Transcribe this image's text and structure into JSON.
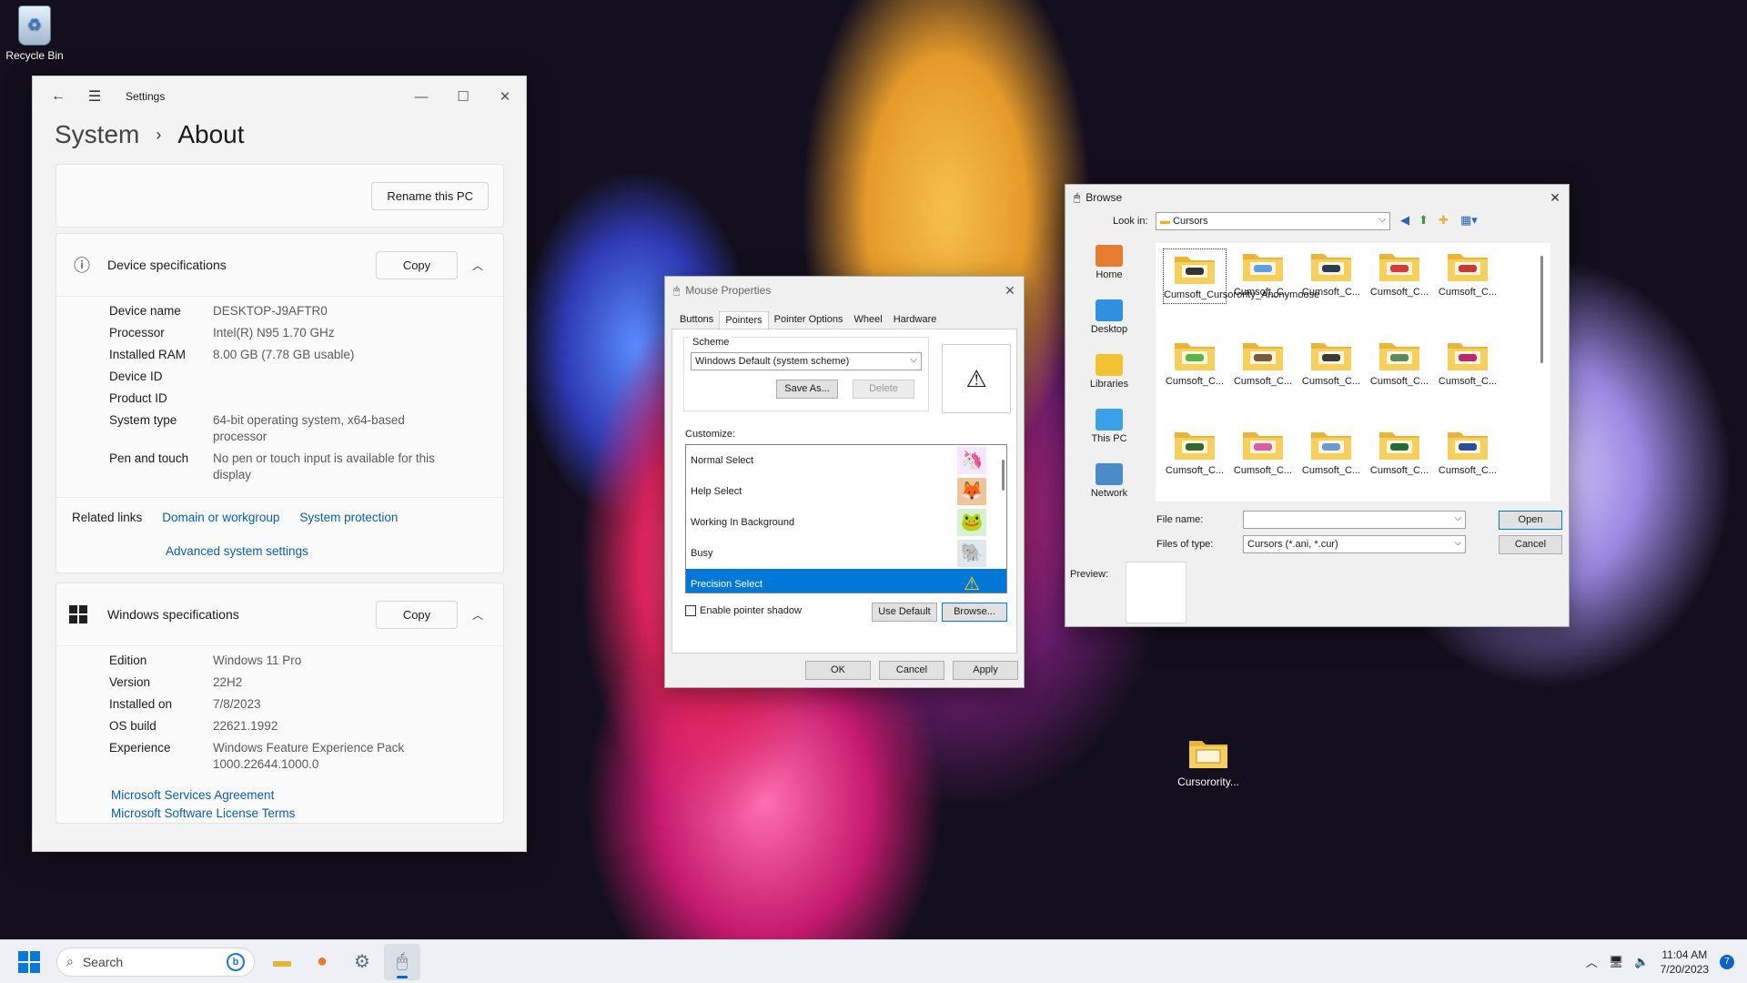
{
  "desktop": {
    "recycle_bin_label": "Recycle Bin",
    "cursority_label": "Cursorority..."
  },
  "settings": {
    "app_title": "Settings",
    "breadcrumb_parent": "System",
    "breadcrumb_current": "About",
    "rename_button": "Rename this PC",
    "device_specs": {
      "title": "Device specifications",
      "copy_button": "Copy",
      "rows": [
        {
          "k": "Device name",
          "v": "DESKTOP-J9AFTR0"
        },
        {
          "k": "Processor",
          "v": "Intel(R) N95   1.70 GHz"
        },
        {
          "k": "Installed RAM",
          "v": "8.00 GB (7.78 GB usable)"
        },
        {
          "k": "Device ID",
          "v": ""
        },
        {
          "k": "Product ID",
          "v": ""
        },
        {
          "k": "System type",
          "v": "64-bit operating system, x64-based processor"
        },
        {
          "k": "Pen and touch",
          "v": "No pen or touch input is available for this display"
        }
      ]
    },
    "related": {
      "label": "Related links",
      "domain_link": "Domain or workgroup",
      "protection_link": "System protection",
      "advanced_link": "Advanced system settings"
    },
    "windows_specs": {
      "title": "Windows specifications",
      "copy_button": "Copy",
      "rows": [
        {
          "k": "Edition",
          "v": "Windows 11 Pro"
        },
        {
          "k": "Version",
          "v": "22H2"
        },
        {
          "k": "Installed on",
          "v": "7/8/2023"
        },
        {
          "k": "OS build",
          "v": "22621.1992"
        },
        {
          "k": "Experience",
          "v": "Windows Feature Experience Pack 1000.22644.1000.0"
        }
      ],
      "msa_link": "Microsoft Services Agreement",
      "license_link": "Microsoft Software License Terms"
    }
  },
  "mouse": {
    "title": "Mouse Properties",
    "tabs": [
      "Buttons",
      "Pointers",
      "Pointer Options",
      "Wheel",
      "Hardware"
    ],
    "active_tab": "Pointers",
    "scheme_label": "Scheme",
    "scheme_value": "Windows Default (system scheme)",
    "save_as": "Save As...",
    "delete": "Delete",
    "customize_label": "Customize:",
    "cursors": [
      {
        "label": "Normal Select",
        "icon": "jester-cursor-icon",
        "glyph": "🦄",
        "bg": "#f4e7ff"
      },
      {
        "label": "Help Select",
        "icon": "fox-cursor-icon",
        "glyph": "🦊",
        "bg": "#f0c49a"
      },
      {
        "label": "Working In Background",
        "icon": "frog-cursor-icon",
        "glyph": "🐸",
        "bg": "#d6f2d2"
      },
      {
        "label": "Busy",
        "icon": "elephant-cursor-icon",
        "glyph": "🐘",
        "bg": "#dfe7ef"
      },
      {
        "label": "Precision Select",
        "icon": "fox-warning-cursor-icon",
        "glyph": "⚠",
        "bg": "transparent"
      }
    ],
    "selected_cursor": "Precision Select",
    "shadow_label": "Enable pointer shadow",
    "use_default": "Use Default",
    "browse": "Browse...",
    "ok": "OK",
    "cancel": "Cancel",
    "apply": "Apply"
  },
  "browse": {
    "title": "Browse",
    "look_in_label": "Look in:",
    "look_in_value": "Cursors",
    "places": [
      {
        "label": "Home",
        "color": "#e57c2f"
      },
      {
        "label": "Desktop",
        "color": "#2f8fe0"
      },
      {
        "label": "Libraries",
        "color": "#f1c232"
      },
      {
        "label": "This PC",
        "color": "#3aa0e8"
      },
      {
        "label": "Network",
        "color": "#4a8cc9"
      }
    ],
    "files": [
      {
        "label": "Cumsoft_Cursorority_Anonymoose",
        "accent": "#333333"
      },
      {
        "label": "Cumsoft_C...",
        "accent": "#5aa0e6"
      },
      {
        "label": "Cumsoft_C...",
        "accent": "#2b3a55"
      },
      {
        "label": "Cumsoft_C...",
        "accent": "#d93a3a"
      },
      {
        "label": "Cumsoft_C...",
        "accent": "#c8373b"
      },
      {
        "label": "Cumsoft_C...",
        "accent": "#56b848"
      },
      {
        "label": "Cumsoft_C...",
        "accent": "#7a5a3a"
      },
      {
        "label": "Cumsoft_C...",
        "accent": "#3a3a3a"
      },
      {
        "label": "Cumsoft_C...",
        "accent": "#5b8a5b"
      },
      {
        "label": "Cumsoft_C...",
        "accent": "#c0256f"
      },
      {
        "label": "Cumsoft_C...",
        "accent": "#2f6b2f"
      },
      {
        "label": "Cumsoft_C...",
        "accent": "#e05aa8"
      },
      {
        "label": "Cumsoft_C...",
        "accent": "#6a9cd0"
      },
      {
        "label": "Cumsoft_C...",
        "accent": "#246b3a"
      },
      {
        "label": "Cumsoft_C...",
        "accent": "#2a4f9c"
      }
    ],
    "file_name_label": "File name:",
    "file_name_value": "",
    "files_type_label": "Files of type:",
    "files_type_value": "Cursors (*.ani, *.cur)",
    "open": "Open",
    "cancel": "Cancel",
    "preview_label": "Preview:"
  },
  "taskbar": {
    "search_placeholder": "Search",
    "time": "11:04 AM",
    "date": "7/20/2023",
    "notifications": "7"
  }
}
